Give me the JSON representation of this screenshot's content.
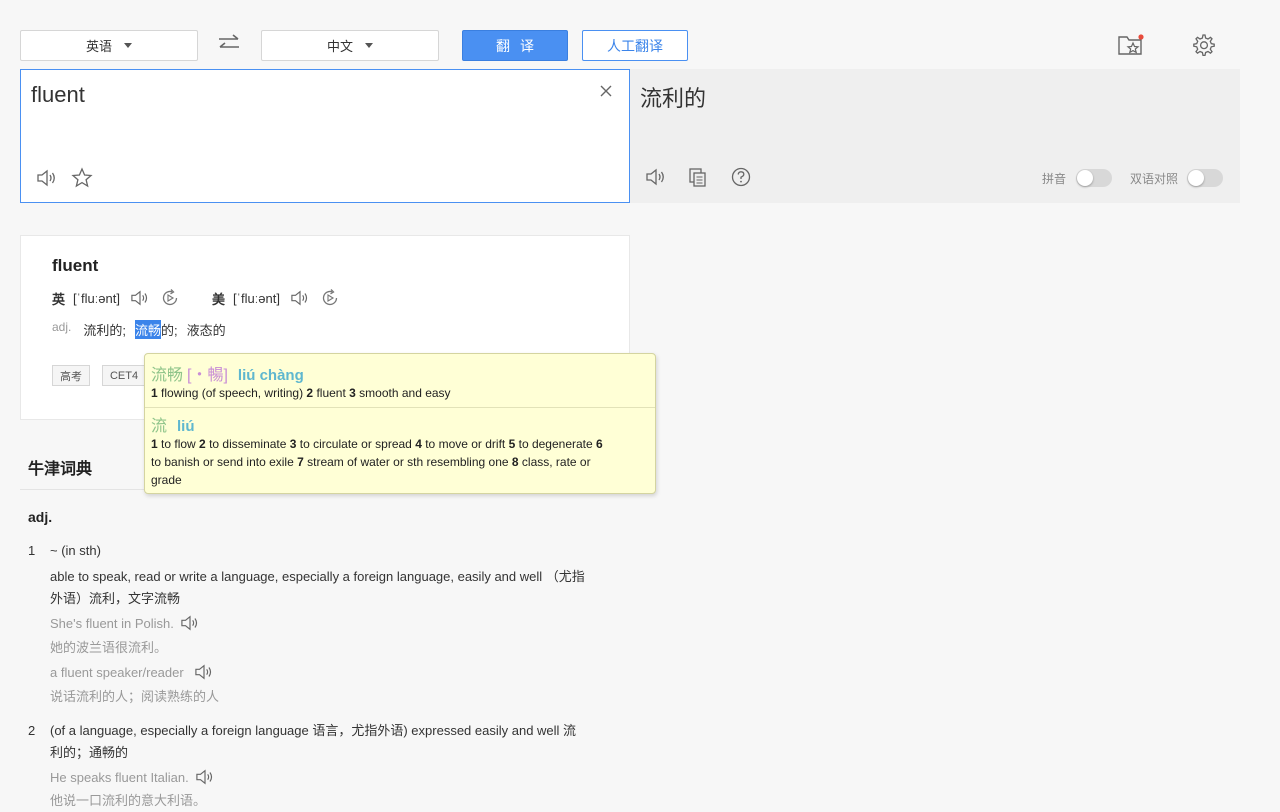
{
  "toolbar": {
    "source_lang": "英语",
    "target_lang": "中文",
    "translate_label": "翻译",
    "human_translate_label": "人工翻译"
  },
  "input": {
    "text": "fluent"
  },
  "output": {
    "text": "流利的",
    "pinyin_label": "拼音",
    "bilingual_label": "双语对照",
    "pinyin_enabled": false,
    "bilingual_enabled": false
  },
  "dictionary": {
    "word": "fluent",
    "uk": {
      "region": "英",
      "ipa": "[ˈfluːənt]"
    },
    "us": {
      "region": "美",
      "ipa": "[ˈfluːənt]"
    },
    "pos": "adj.",
    "meaning_1": "流利的;",
    "meaning_2_highlight": "流畅",
    "meaning_2_rest": "的;",
    "meaning_3": "液态的",
    "tags": [
      "高考",
      "CET4"
    ]
  },
  "popup": {
    "entry1": {
      "hanzi": "流畅",
      "traditional": "[・暢]",
      "pinyin": "liú chàng",
      "defs": [
        {
          "n": "1",
          "t": "flowing (of speech, writing)"
        },
        {
          "n": "2",
          "t": "fluent"
        },
        {
          "n": "3",
          "t": "smooth and easy"
        }
      ]
    },
    "entry2": {
      "hanzi": "流",
      "pinyin": "liú",
      "defs": [
        {
          "n": "1",
          "t": "to flow"
        },
        {
          "n": "2",
          "t": "to disseminate"
        },
        {
          "n": "3",
          "t": "to circulate or spread"
        },
        {
          "n": "4",
          "t": "to move or drift"
        },
        {
          "n": "5",
          "t": "to degenerate"
        },
        {
          "n": "6",
          "t": "to banish or send into exile"
        },
        {
          "n": "7",
          "t": "stream of water or sth resembling one"
        },
        {
          "n": "8",
          "t": "class, rate or grade"
        }
      ]
    }
  },
  "oxford": {
    "title": "牛津词典",
    "pos": "adj.",
    "sense1": {
      "num": "1",
      "pattern": "~ (in sth)",
      "def_line1": "able to speak, read or write a language, especially a foreign language, easily and well （尤指",
      "def_line2": "外语）流利，文字流畅",
      "ex1_en": "She's fluent in Polish.",
      "ex1_zh": "她的波兰语很流利。",
      "ex2_en": "a fluent speaker/reader",
      "ex2_zh": "说话流利的人；阅读熟练的人"
    },
    "sense2": {
      "num": "2",
      "def_line1": "(of a language, especially a foreign language 语言，尤指外语) expressed easily and well 流",
      "def_line2": "利的；通畅的",
      "ex1_en": "He speaks fluent Italian.",
      "ex1_zh": "他说一口流利的意大利语。"
    }
  }
}
